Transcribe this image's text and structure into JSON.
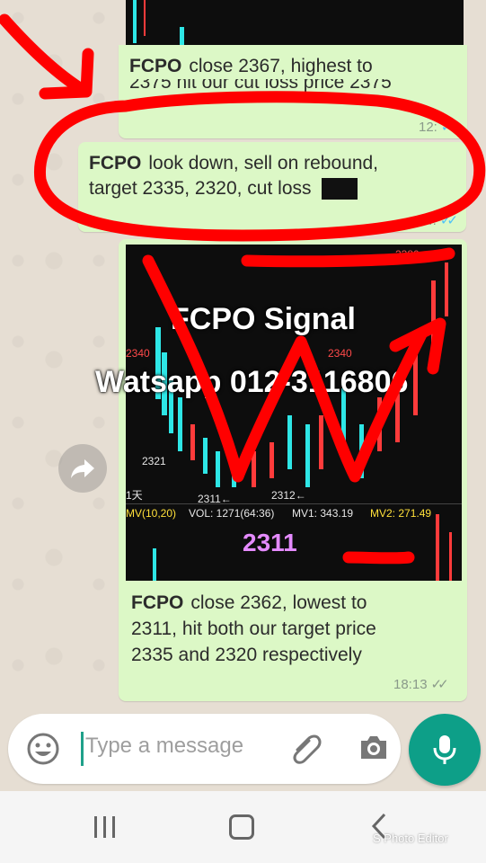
{
  "messages": [
    {
      "sender": "FCPO",
      "text": "close 2367, highest to",
      "text_cut": "2375 hit our cut loss price 2375",
      "time": "12:"
    },
    {
      "sender": "FCPO",
      "line1": "look down,  sell on rebound,",
      "line2": "target  2335, 2320, cut loss",
      "time": "14:"
    },
    {
      "sender": "FCPO",
      "line1": "close  2362, lowest to",
      "line2": "2311, hit both our target price",
      "line3": "2335 and 2320 respectively",
      "time": "18:13"
    }
  ],
  "chart_image": {
    "price_labels": [
      "2340",
      "2340",
      "2321",
      "2311←",
      "2312←",
      "2380"
    ],
    "period_label": "1天",
    "indicators": {
      "mv": "MV(10,20)",
      "vol": "VOL: 1271(64:36)",
      "mv1": "MV1: 343.19",
      "mv2": "MV2: 271.49"
    },
    "big_value": "2311"
  },
  "overlay": {
    "title": "FCPO Signal",
    "contact": "Watsapp  012-3116806"
  },
  "composer": {
    "placeholder": "Type a message"
  },
  "watermark": "S Photo Editor",
  "icons": [
    "forward-icon",
    "emoji-icon",
    "attach-icon",
    "camera-icon",
    "mic-icon",
    "recent-apps-icon",
    "home-icon",
    "back-icon"
  ],
  "colors": {
    "bubble": "#dcf8c6",
    "accent": "#0d9f88",
    "annotation": "#ff0000"
  }
}
